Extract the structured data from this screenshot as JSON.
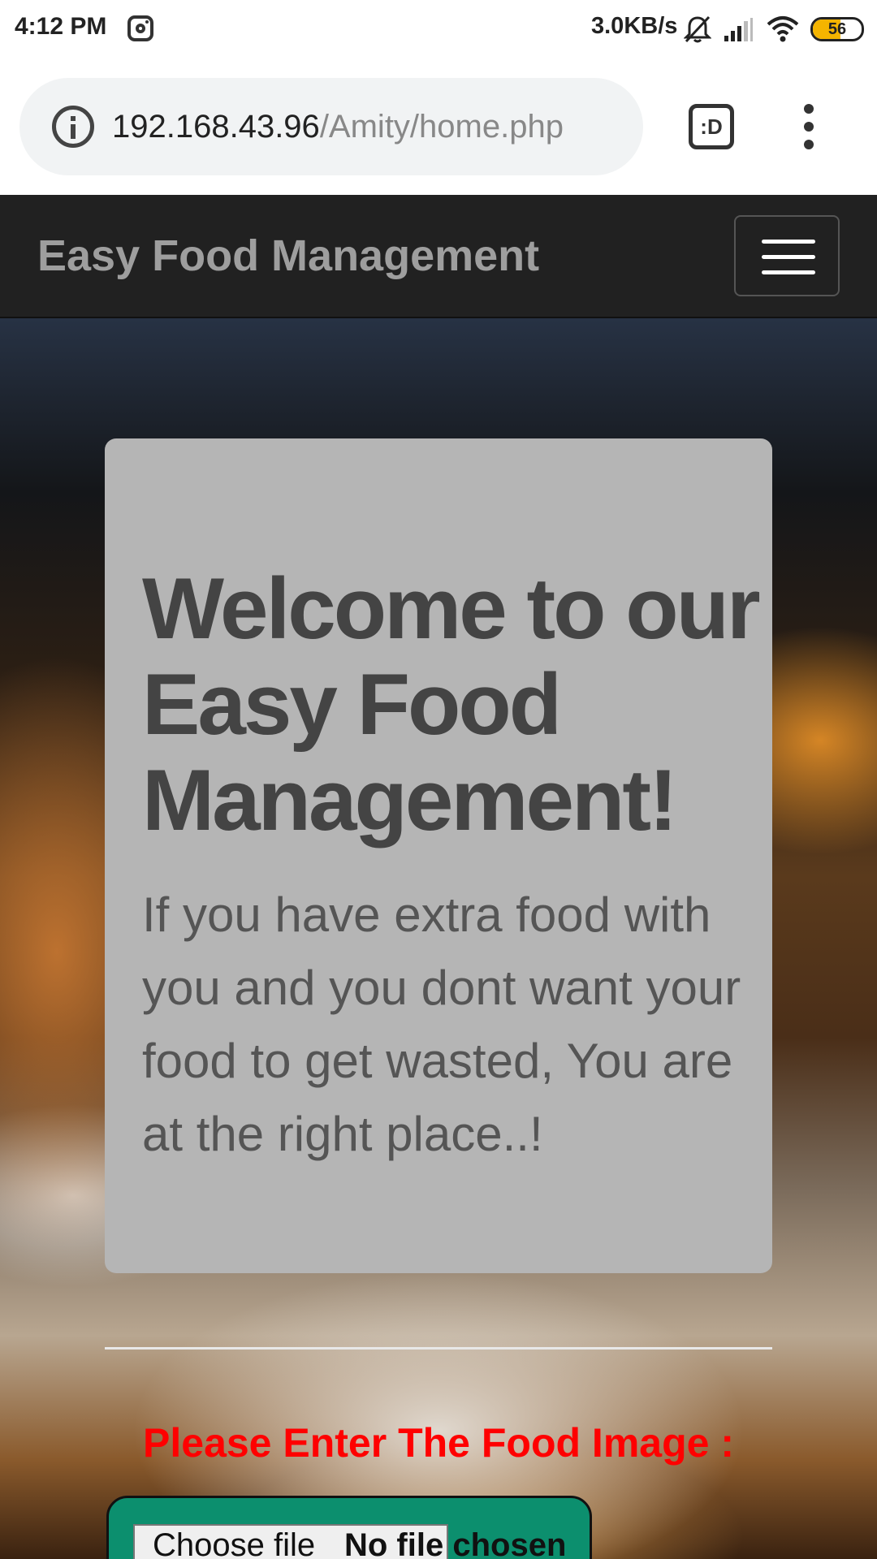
{
  "status_bar": {
    "time": "4:12 PM",
    "net_speed": "3.0KB/s",
    "battery_level": "56",
    "battery_fraction": 0.56,
    "icons": [
      "instagram-icon",
      "mute-icon",
      "signal-icon",
      "wifi-icon",
      "battery-icon"
    ]
  },
  "browser": {
    "url_host": "192.168.43.96",
    "url_path": "/Amity/home.php",
    "extension_label": ":D",
    "icons": [
      "info-icon",
      "extension-icon",
      "more-vert-icon"
    ]
  },
  "navbar": {
    "brand": "Easy Food Management",
    "toggler_icon": "hamburger-menu-icon"
  },
  "jumbotron": {
    "title": "Welcome to our Easy Food Management!",
    "lead": "If you have extra food with you and you dont want your food to get wasted, You are at the right place..!"
  },
  "upload": {
    "label": "Please Enter The Food Image :",
    "button_label": "Choose file",
    "status": "No file chosen"
  },
  "colors": {
    "navbar_bg": "#212121",
    "brand_text": "#9e9e9e",
    "card_bg": "#b5b5b5",
    "label_red": "#ff0000",
    "file_box_green": "#0c8f6e",
    "battery_yellow": "#f4b400"
  }
}
